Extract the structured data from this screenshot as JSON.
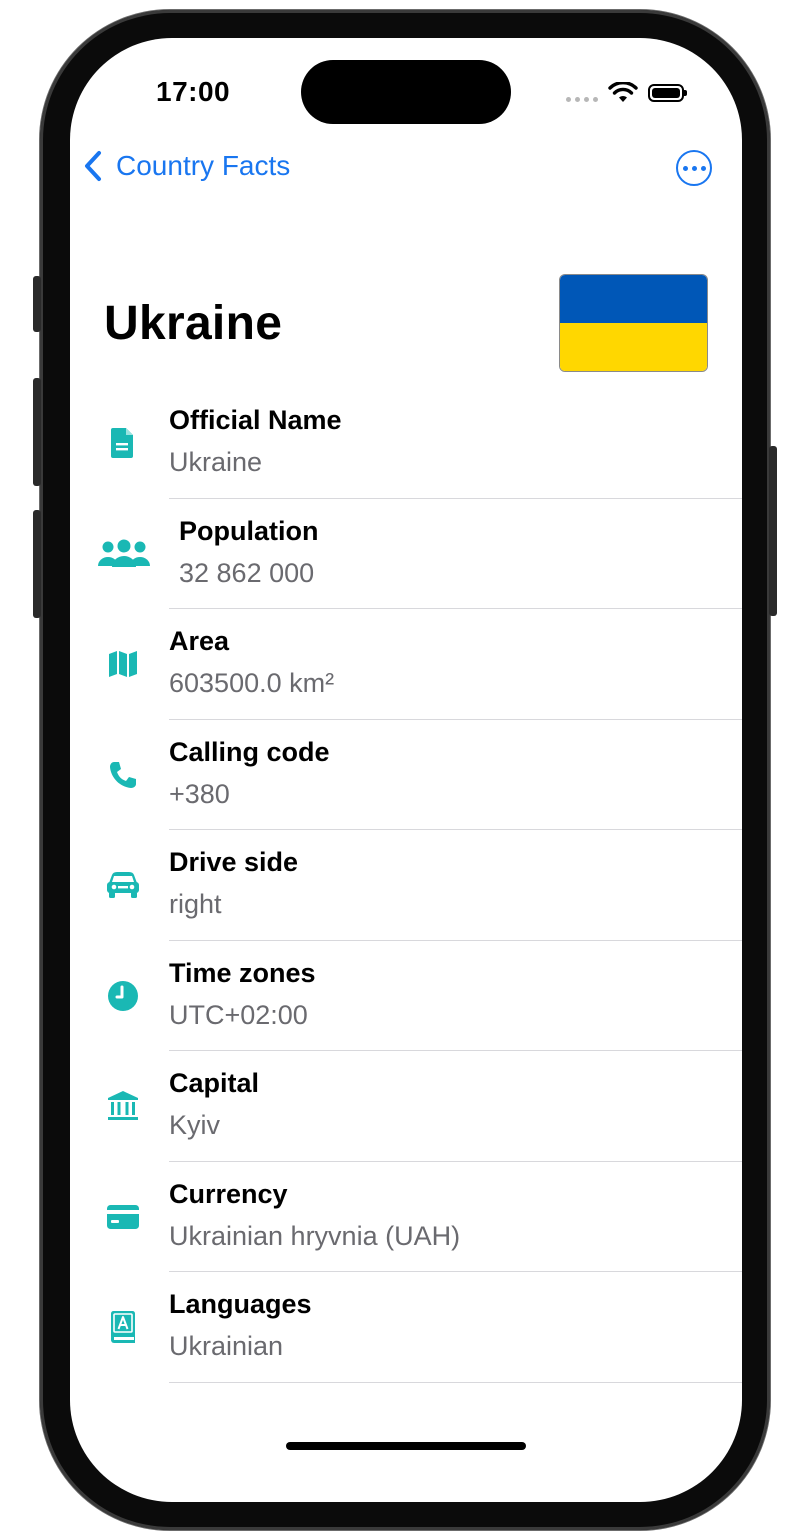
{
  "status_bar": {
    "time": "17:00"
  },
  "nav": {
    "back_label": "Country Facts"
  },
  "country": {
    "name": "Ukraine"
  },
  "flag": {
    "top_color": "#0057B7",
    "bottom_color": "#FFD700"
  },
  "accent_color": "#1AB8B4",
  "rows": [
    {
      "icon": "document-icon",
      "label": "Official Name",
      "value": "Ukraine"
    },
    {
      "icon": "people-icon",
      "label": "Population",
      "value": "32 862 000"
    },
    {
      "icon": "map-icon",
      "label": "Area",
      "value": "603500.0 km²"
    },
    {
      "icon": "phone-icon",
      "label": "Calling code",
      "value": "+380"
    },
    {
      "icon": "car-icon",
      "label": "Drive side",
      "value": "right"
    },
    {
      "icon": "clock-icon",
      "label": "Time zones",
      "value": "UTC+02:00"
    },
    {
      "icon": "bank-icon",
      "label": "Capital",
      "value": "Kyiv"
    },
    {
      "icon": "creditcard-icon",
      "label": "Currency",
      "value": "Ukrainian hryvnia (UAH)"
    },
    {
      "icon": "dictionary-icon",
      "label": "Languages",
      "value": "Ukrainian"
    }
  ]
}
